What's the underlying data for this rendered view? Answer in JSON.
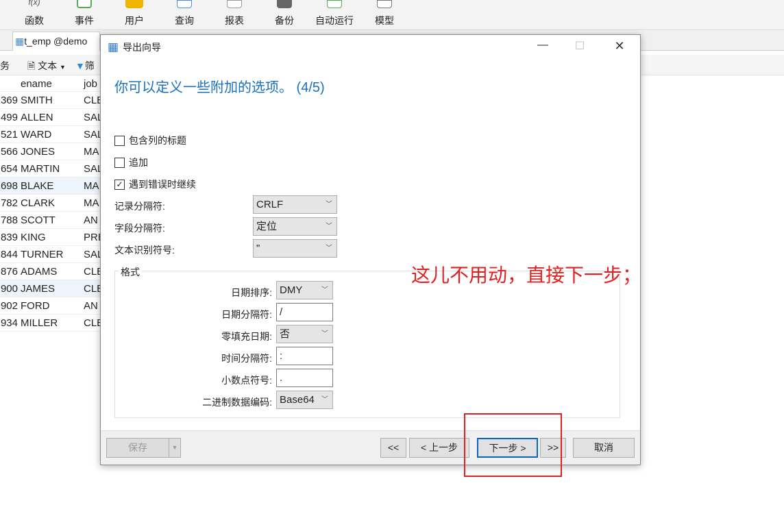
{
  "toolbar": {
    "items": [
      {
        "label": "函数",
        "icon": "function-icon"
      },
      {
        "label": "事件",
        "icon": "event-clock-icon"
      },
      {
        "label": "用户",
        "icon": "user-icon"
      },
      {
        "label": "查询",
        "icon": "query-icon"
      },
      {
        "label": "报表",
        "icon": "report-icon"
      },
      {
        "label": "备份",
        "icon": "backup-icon"
      },
      {
        "label": "自动运行",
        "icon": "schedule-icon"
      },
      {
        "label": "模型",
        "icon": "model-icon"
      }
    ]
  },
  "tab": {
    "label": "t_emp @demo"
  },
  "subtoolbar": {
    "left": "务",
    "text": "文本",
    "filter": "筛"
  },
  "grid": {
    "headers": [
      "ename",
      "job"
    ],
    "rows": [
      [
        "369",
        "SMITH",
        "CLE"
      ],
      [
        "499",
        "ALLEN",
        "SAL"
      ],
      [
        "521",
        "WARD",
        "SAL"
      ],
      [
        "566",
        "JONES",
        "MA"
      ],
      [
        "654",
        "MARTIN",
        "SAL"
      ],
      [
        "698",
        "BLAKE",
        "MA"
      ],
      [
        "782",
        "CLARK",
        "MA"
      ],
      [
        "788",
        "SCOTT",
        "AN"
      ],
      [
        "839",
        "KING",
        "PRE"
      ],
      [
        "844",
        "TURNER",
        "SAL"
      ],
      [
        "876",
        "ADAMS",
        "CLE"
      ],
      [
        "900",
        "JAMES",
        "CLE"
      ],
      [
        "902",
        "FORD",
        "AN"
      ],
      [
        "934",
        "MILLER",
        "CLE"
      ]
    ]
  },
  "dialog": {
    "title": "导出向导",
    "heading": "你可以定义一些附加的选项。 (4/5)",
    "checkboxes": [
      {
        "label": "包含列的标题",
        "checked": false
      },
      {
        "label": "追加",
        "checked": false
      },
      {
        "label": "遇到错误时继续",
        "checked": true
      }
    ],
    "record_sep": {
      "label": "记录分隔符:",
      "value": "CRLF"
    },
    "field_sep": {
      "label": "字段分隔符:",
      "value": "定位"
    },
    "text_qual": {
      "label": "文本识别符号:",
      "value": "\""
    },
    "format": {
      "legend": "格式",
      "date_order": {
        "label": "日期排序:",
        "value": "DMY"
      },
      "date_sep": {
        "label": "日期分隔符:",
        "value": "/"
      },
      "zero_pad": {
        "label": "零填充日期:",
        "value": "否"
      },
      "time_sep": {
        "label": "时间分隔符:",
        "value": ":"
      },
      "decimal": {
        "label": "小数点符号:",
        "value": "."
      },
      "binary": {
        "label": "二进制数据编码:",
        "value": "Base64"
      }
    },
    "buttons": {
      "save": "保存",
      "first": "<<",
      "prev": "< 上一步",
      "next": "下一步 >",
      "last": ">>",
      "cancel": "取消"
    }
  },
  "annotation": "这儿不用动，直接下一步；",
  "colors": {
    "heading": "#1a70c0",
    "annotation": "#e52020"
  }
}
